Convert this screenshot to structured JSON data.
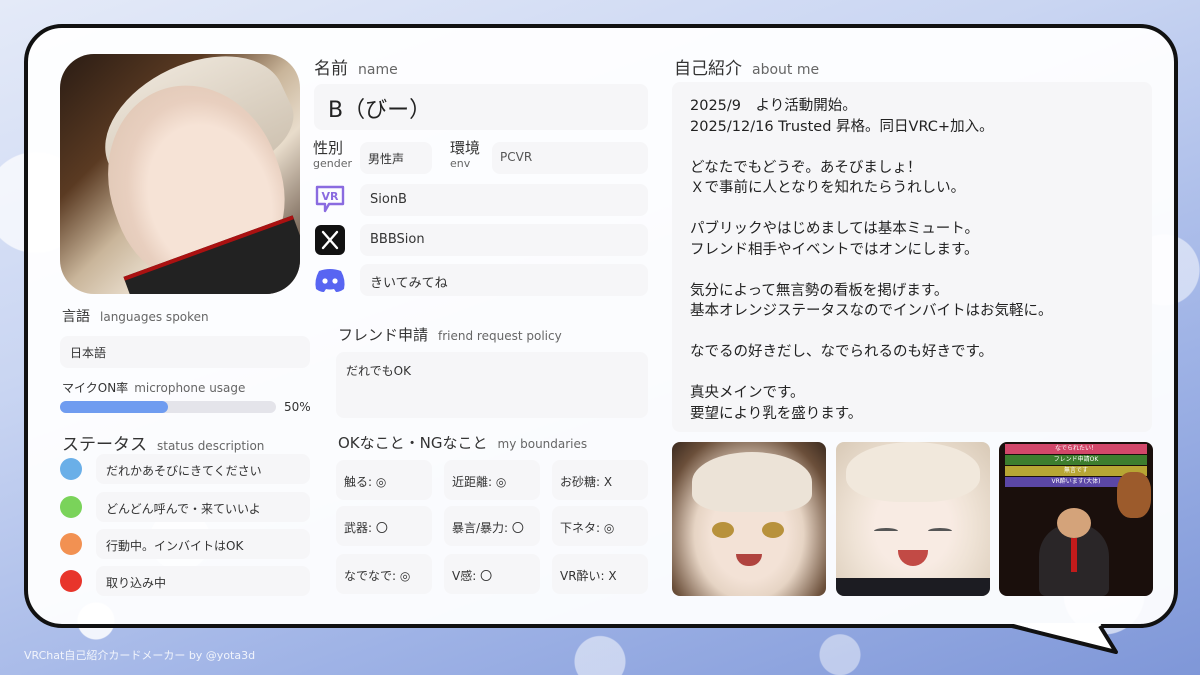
{
  "profile": {
    "name_label_ja": "名前",
    "name_label_en": "name",
    "name_value": "B（びー）",
    "gender_label_ja": "性別",
    "gender_label_en": "gender",
    "gender_value": "男性声",
    "env_label_ja": "環境",
    "env_label_en": "env",
    "env_value": "PCVR",
    "vrchat_id": "SionB",
    "x_id": "BBBSion",
    "discord_text": "きいてみてね"
  },
  "languages": {
    "label_ja": "言語",
    "label_en": "languages spoken",
    "value": "日本語"
  },
  "mic": {
    "label_ja": "マイクON率",
    "label_en": "microphone usage",
    "percent_text": "50%",
    "fraction": 0.5
  },
  "status": {
    "label_ja": "ステータス",
    "label_en": "status description",
    "items": [
      {
        "text": "だれかあそびにきてください",
        "color": "#6aafe8"
      },
      {
        "text": "どんどん呼んで・来ていいよ",
        "color": "#7ad35a"
      },
      {
        "text": "行動中。インバイトはOK",
        "color": "#f29152"
      },
      {
        "text": "取り込み中",
        "color": "#e8352b"
      }
    ]
  },
  "friend_request": {
    "label_ja": "フレンド申請",
    "label_en": "friend request policy",
    "value": "だれでもOK"
  },
  "boundaries": {
    "label_ja": "OKなこと・NGなこと",
    "label_en": "my boundaries",
    "items": [
      "触る: ◎",
      "近距離: ◎",
      "お砂糖: X",
      "武器: 〇",
      "暴言/暴力: 〇",
      "下ネタ: ◎",
      "なでなで: ◎",
      "V感: 〇",
      "VR酔い: X"
    ]
  },
  "about": {
    "label_ja": "自己紹介",
    "label_en": "about me",
    "text": "2025/9　より活動開始。\n2025/12/16 Trusted 昇格。同日VRC+加入。\n\nどなたでもどうぞ。あそびましょ！\nＸで事前に人となりを知れたらうれしい。\n\nパブリックやはじめましては基本ミュート。\nフレンド相手やイベントではオンにします。\n\n気分によって無言勢の看板を掲げます。\n基本オレンジステータスなのでインバイトはお気軽に。\n\nなでるの好きだし、なでられるのも好きです。\n\n真央メインです。\n要望により乳を盛ります。"
  },
  "photo3_signs": [
    "なでられたい！",
    "フレンド申請OK",
    "無言です",
    "VR酔います(大体)"
  ],
  "footer": "VRChat自己紹介カードメーカー by @yota3d",
  "colors": {
    "mic_bar": "#6f9cf0",
    "vr_icon": "#8a6be0",
    "discord": "#5865f2"
  },
  "icons": [
    "vrchat-icon",
    "x-logo-icon",
    "discord-icon"
  ]
}
